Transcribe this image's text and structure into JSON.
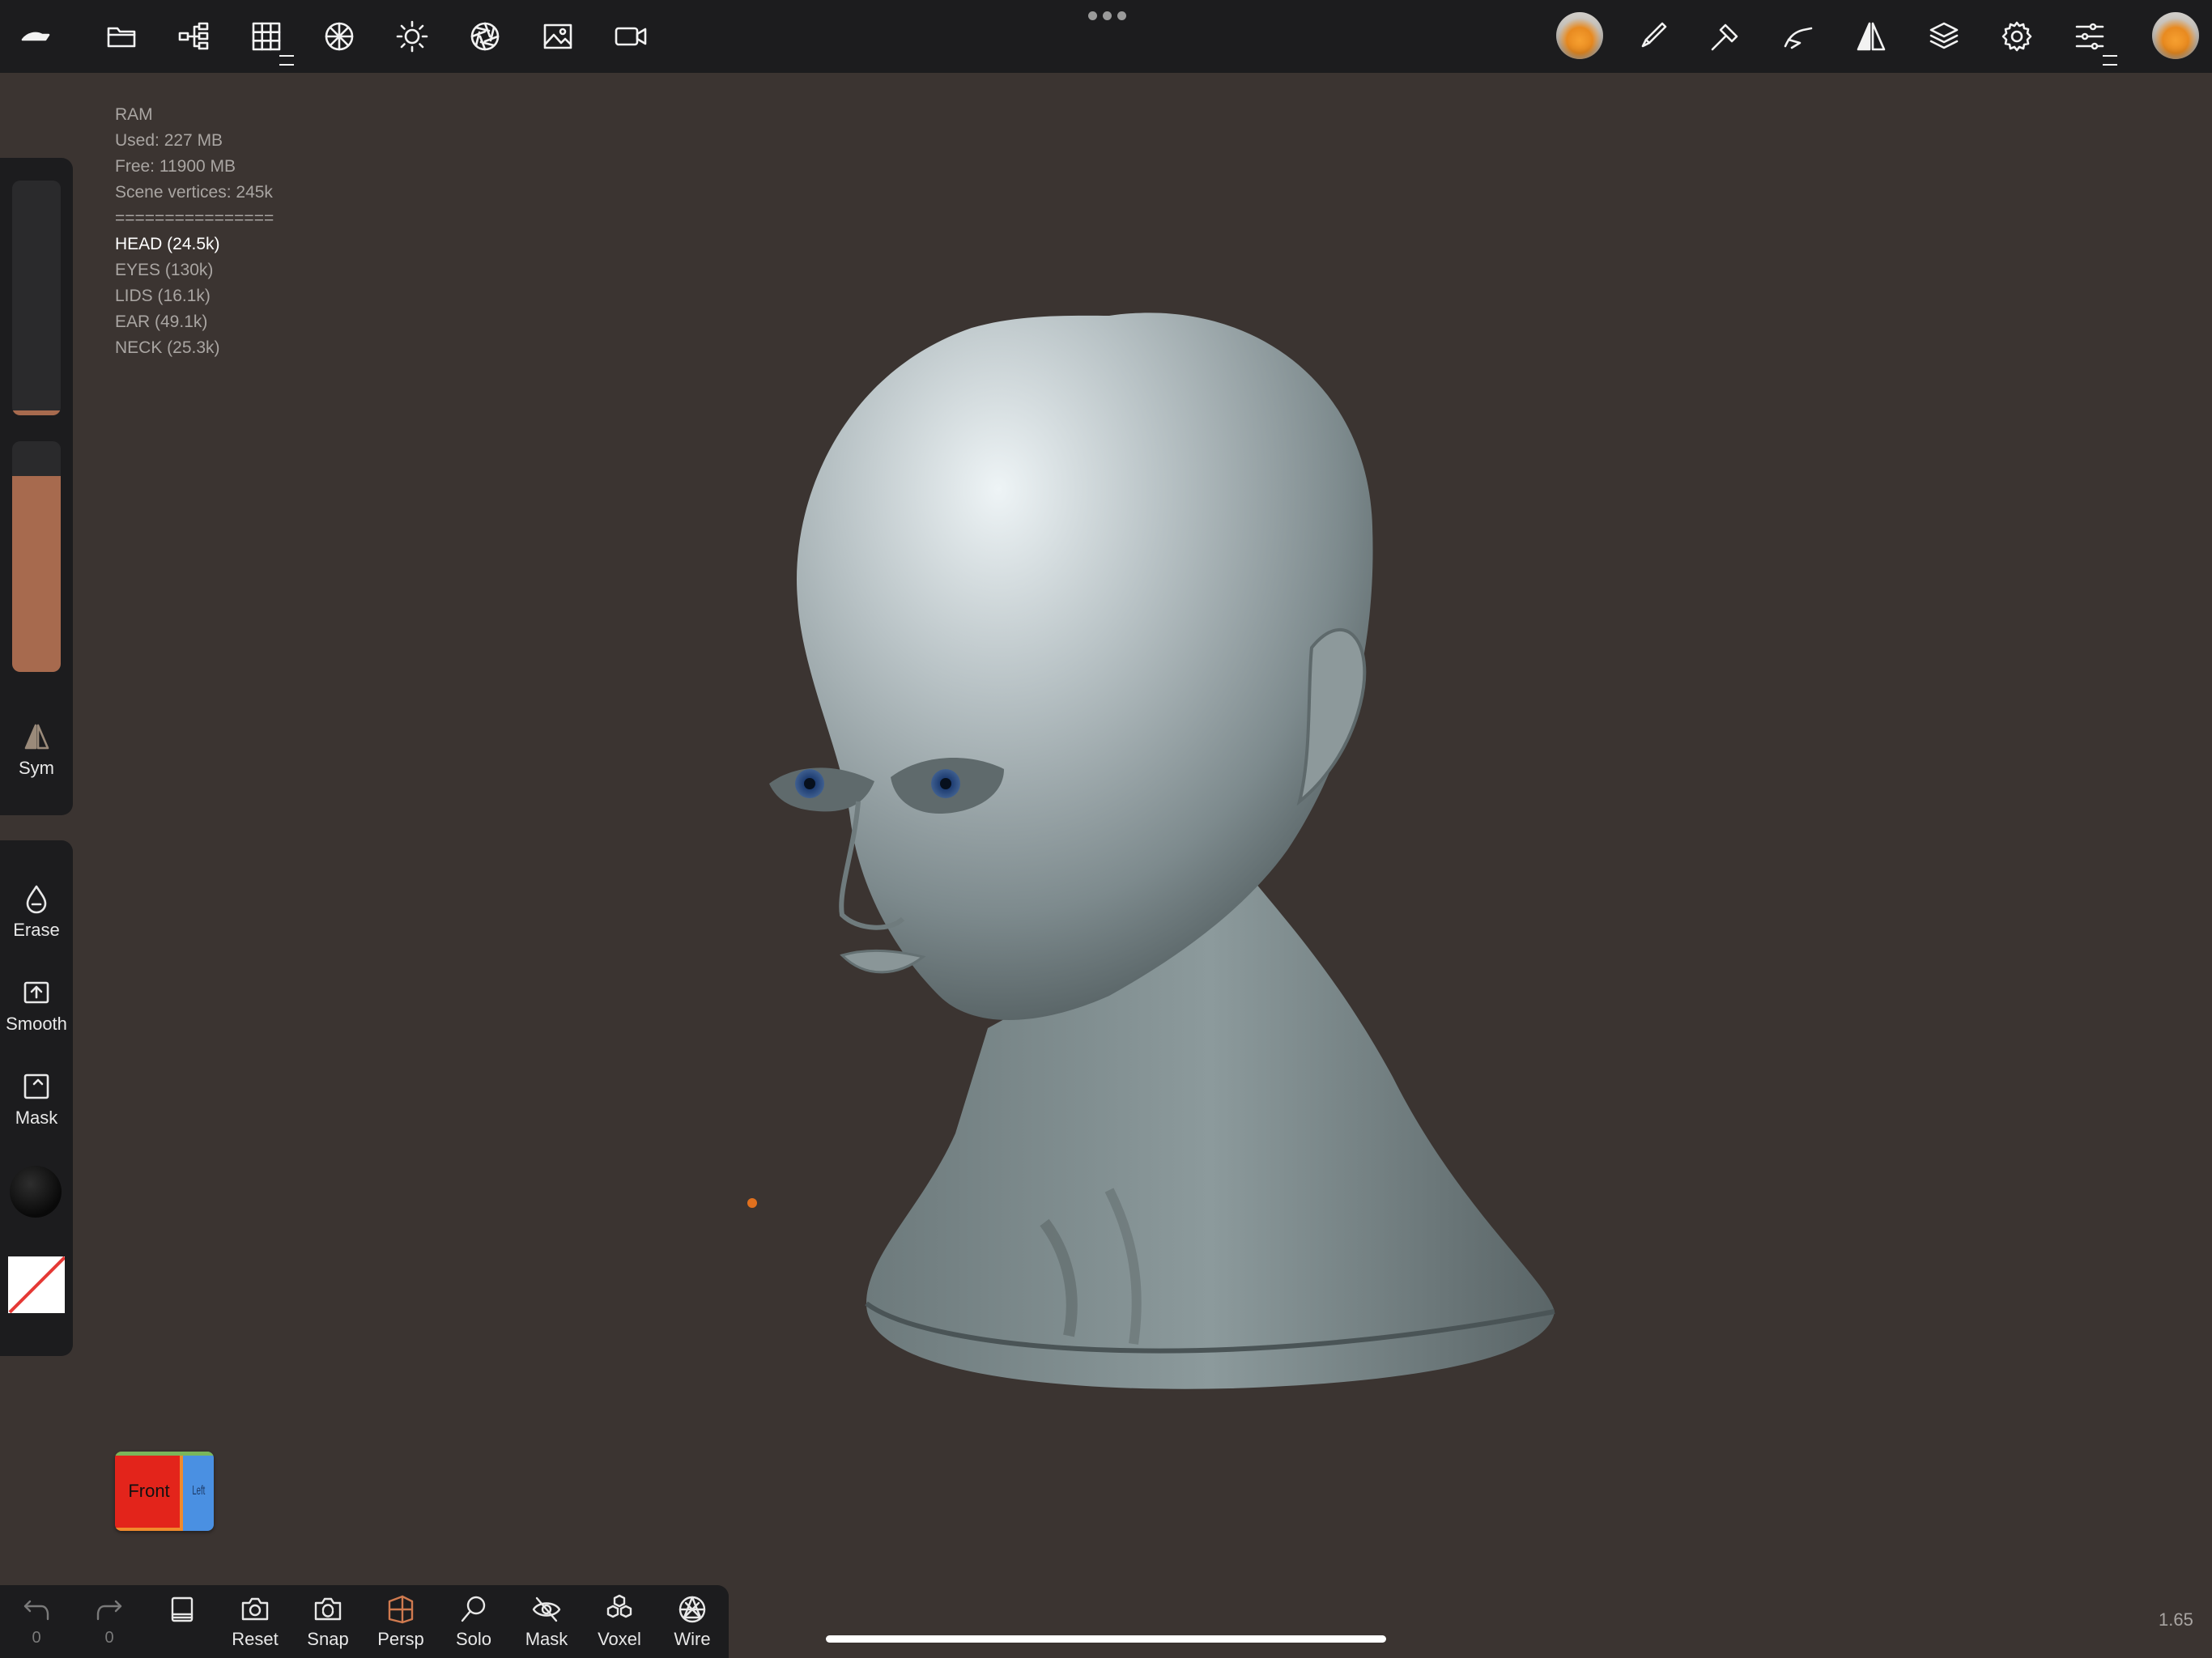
{
  "app": {
    "zoom_level": "1.65"
  },
  "topbar": {
    "left_icons": [
      "app-logo-icon",
      "folder-icon",
      "scene-tree-icon",
      "grid-icon",
      "topology-icon",
      "light-icon",
      "aperture-icon",
      "image-icon",
      "camera-icon"
    ],
    "right_icons": [
      "material-ball-icon",
      "brush-icon",
      "hammer-icon",
      "stroke-icon",
      "symmetry-icon",
      "layers-icon",
      "settings-icon",
      "sliders-icon",
      "material-ball-icon"
    ]
  },
  "stats": {
    "ram_label": "RAM",
    "used": "Used: 227 MB",
    "free": "Free: 11900 MB",
    "vertices": "Scene vertices: 245k",
    "separator": "================",
    "objects": [
      "HEAD (24.5k)",
      "EYES (130k)",
      "LIDS (16.1k)",
      "EAR (49.1k)",
      "NECK (25.3k)"
    ],
    "active_object": "HEAD (24.5k)"
  },
  "left_panel": {
    "radius_level": 0.02,
    "intensity_level": 0.85,
    "sym_label": "Sym",
    "erase_label": "Erase",
    "smooth_label": "Smooth",
    "mask_label": "Mask",
    "brush_color": "#a76a4e"
  },
  "viewcube": {
    "front": "Front",
    "left": "Left"
  },
  "bottombar": {
    "undo_count": "0",
    "redo_count": "0",
    "reset": "Reset",
    "snap": "Snap",
    "persp": "Persp",
    "solo": "Solo",
    "mask": "Mask",
    "voxel": "Voxel",
    "wire": "Wire"
  }
}
